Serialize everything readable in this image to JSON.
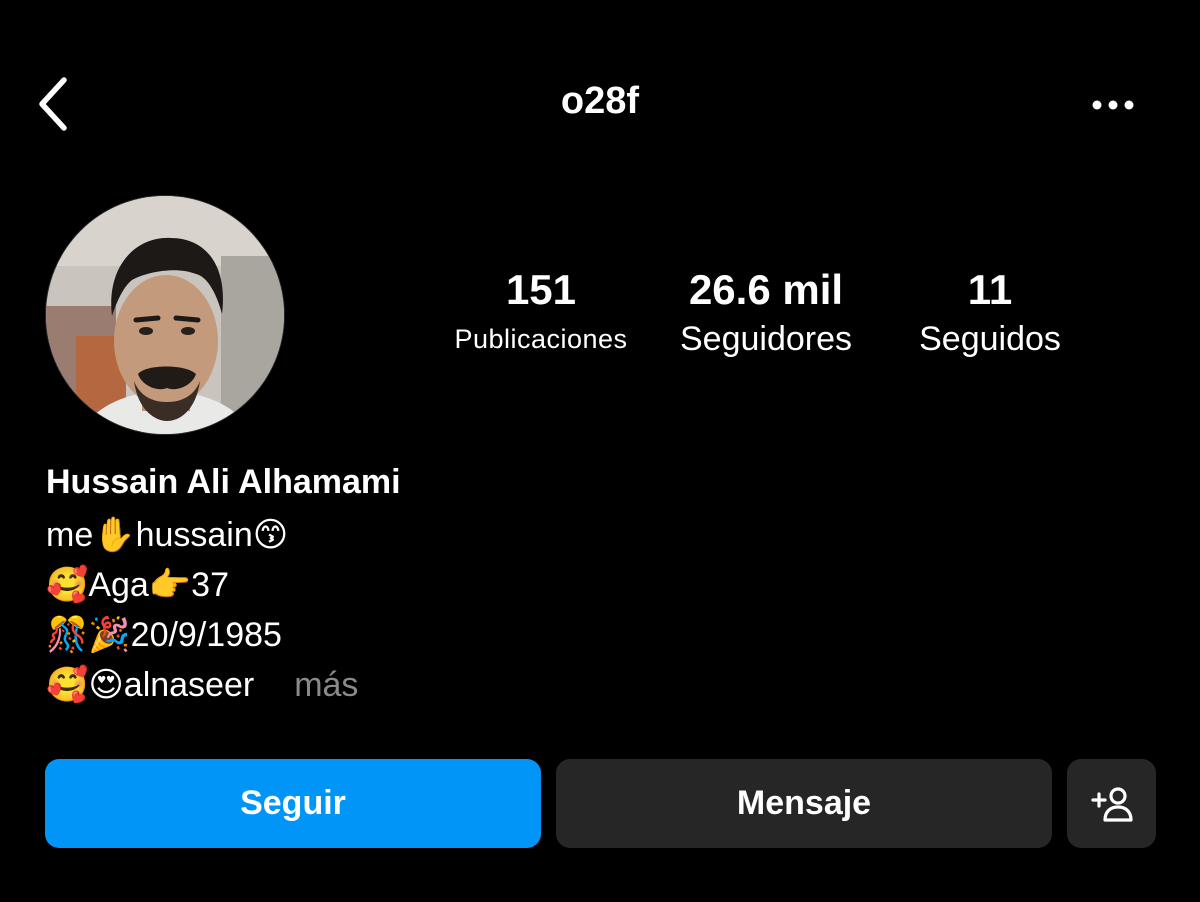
{
  "header": {
    "username": "o28f",
    "back_icon": "chevron-left-icon",
    "more_icon": "more-horizontal-icon"
  },
  "profile": {
    "avatar_icon": "profile-photo"
  },
  "stats": {
    "posts": {
      "value": "151",
      "label": "Publicaciones"
    },
    "followers": {
      "value": "26.6 mil",
      "label": "Seguidores"
    },
    "following": {
      "value": "11",
      "label": "Seguidos"
    }
  },
  "bio": {
    "name": "Hussain Ali Alhamami",
    "lines": [
      "me✋hussain😙",
      "🥰Aga👉37",
      "🎊🎉20/9/1985",
      "🥰😍alnaseer"
    ],
    "more": "más"
  },
  "actions": {
    "follow": "Seguir",
    "message": "Mensaje",
    "add_user_icon": "add-person-icon"
  },
  "colors": {
    "background": "#000000",
    "primary_button": "#0095f6",
    "secondary_button": "#262626",
    "muted_text": "#8a8a8a"
  }
}
